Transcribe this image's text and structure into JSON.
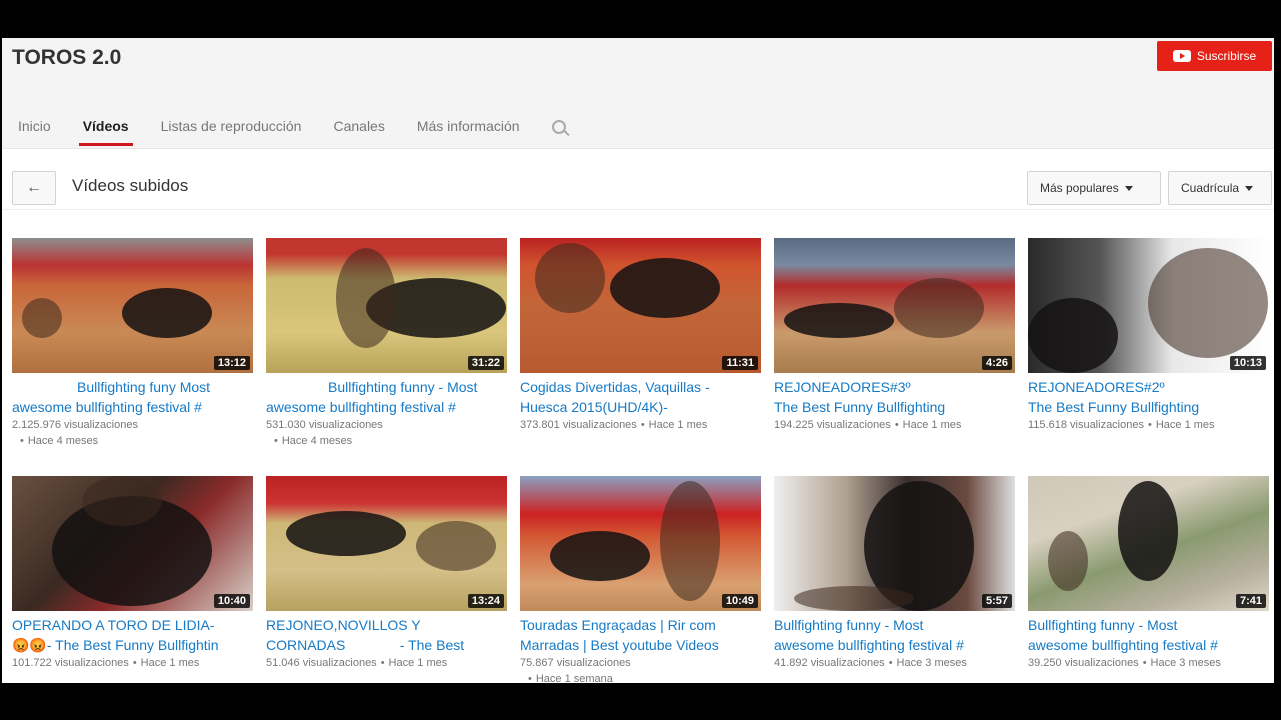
{
  "channel": {
    "title": "TOROS 2.0",
    "subscribe_label": "Suscribirse"
  },
  "tabs": [
    {
      "label": "Inicio",
      "active": false
    },
    {
      "label": "Vídeos",
      "active": true
    },
    {
      "label": "Listas de reproducción",
      "active": false
    },
    {
      "label": "Canales",
      "active": false
    },
    {
      "label": "Más información",
      "active": false
    }
  ],
  "toolbar": {
    "section_title": "Vídeos subidos",
    "sort_label": "Más populares",
    "view_label": "Cuadrícula"
  },
  "videos": [
    {
      "line1": "Bullfighting funy Most",
      "line2": "awesome bullfighting festival #",
      "views": "2.125.976 visualizaciones",
      "age": "Hace 4 meses",
      "duration": "13:12"
    },
    {
      "line1": "Bullfighting funny - Most",
      "line2": "awesome bullfighting festival #",
      "views": "531.030 visualizaciones",
      "age": "Hace 4 meses",
      "duration": "31:22"
    },
    {
      "line1": "Cogidas Divertidas, Vaquillas -",
      "line2": "Huesca 2015(UHD/4K)-",
      "views": "373.801 visualizaciones",
      "age": "Hace 1 mes",
      "duration": "11:31"
    },
    {
      "line1": "REJONEADORES#3º",
      "line2": "The Best Funny Bullfighting",
      "views": "194.225 visualizaciones",
      "age": "Hace 1 mes",
      "duration": "4:26"
    },
    {
      "line1": "REJONEADORES#2º",
      "line2": "The Best Funny Bullfighting",
      "views": "115.618 visualizaciones",
      "age": "Hace 1 mes",
      "duration": "10:13"
    },
    {
      "line1": "OPERANDO A TORO DE LIDIA-",
      "line2": "😡😡- The Best Funny Bullfightin",
      "views": "101.722 visualizaciones",
      "age": "Hace 1 mes",
      "duration": "10:40"
    },
    {
      "line1": "REJONEO,NOVILLOS Y",
      "line2": "CORNADAS              - The Best",
      "views": "51.046 visualizaciones",
      "age": "Hace 1 mes",
      "duration": "13:24"
    },
    {
      "line1": "Touradas Engraçadas | Rir com",
      "line2": "Marradas | Best youtube Videos",
      "views": "75.867 visualizaciones",
      "age": "Hace 1 semana",
      "duration": "10:49"
    },
    {
      "line1": "Bullfighting funny - Most",
      "line2": "awesome bullfighting festival #",
      "views": "41.892 visualizaciones",
      "age": "Hace 3 meses",
      "duration": "5:57"
    },
    {
      "line1": "Bullfighting funny - Most",
      "line2": "awesome bullfighting festival #",
      "views": "39.250 visualizaciones",
      "age": "Hace 3 meses",
      "duration": "7:41"
    }
  ],
  "colors": {
    "accent": "#cc181e",
    "subscribe": "#e62117",
    "link": "#167ac6"
  }
}
